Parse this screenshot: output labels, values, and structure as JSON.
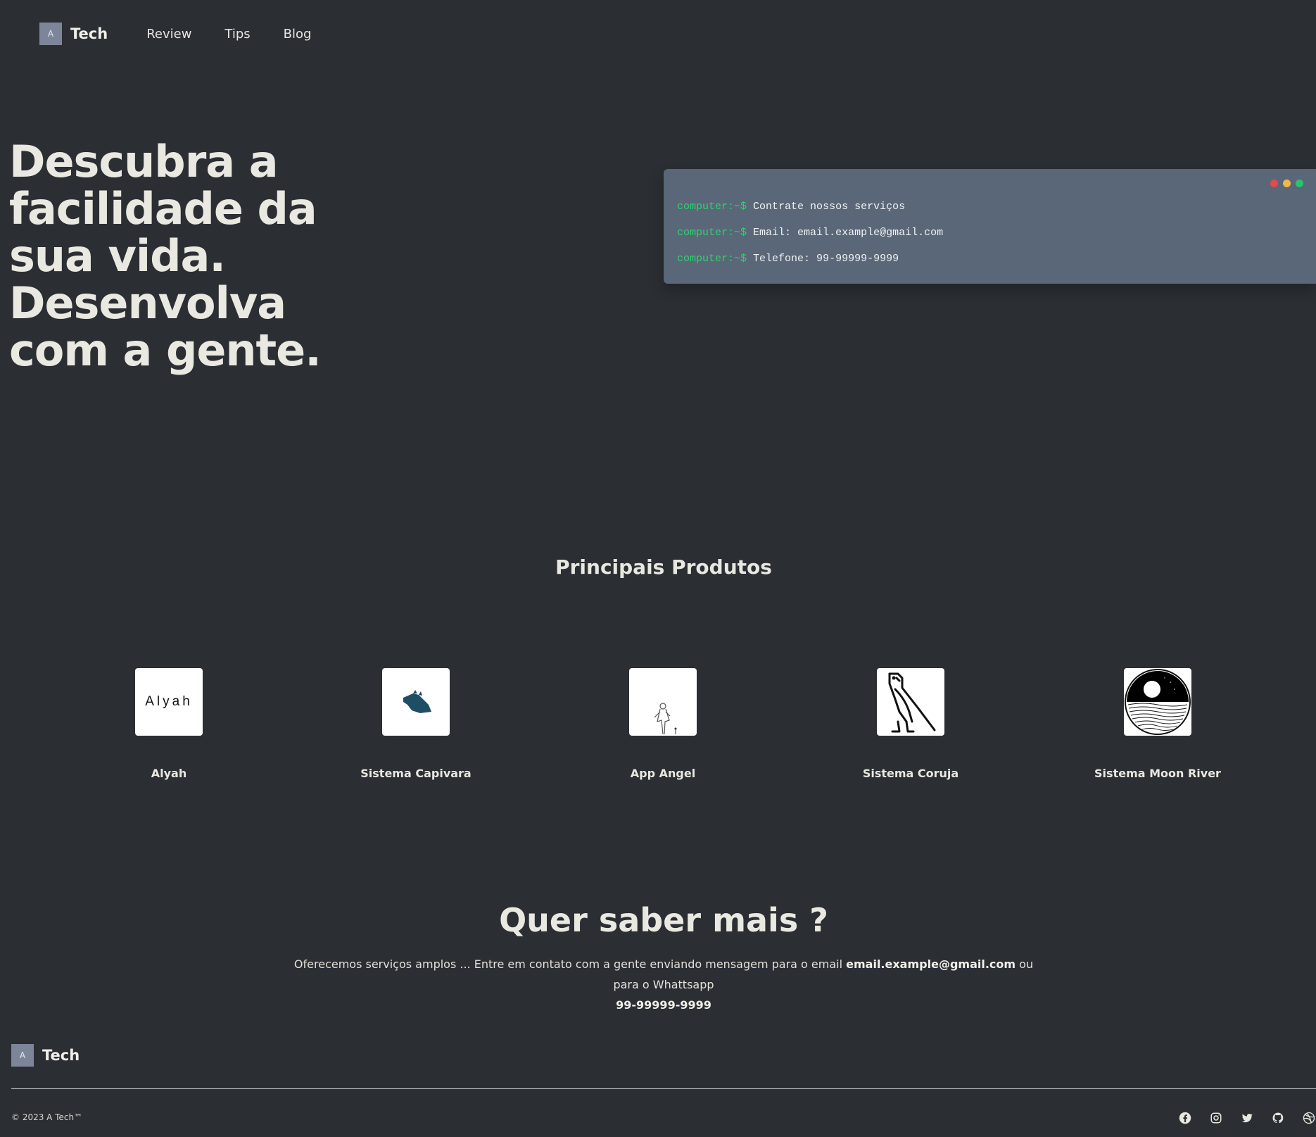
{
  "nav": {
    "logo_letter": "A",
    "logo_text": "Tech",
    "links": [
      "Review",
      "Tips",
      "Blog"
    ]
  },
  "hero": {
    "title": "Descubra a facilidade da sua vida. Desenvolva com a gente."
  },
  "terminal": {
    "prompt": "computer:~$",
    "lines": [
      "Contrate nossos serviços",
      "Email: email.example@gmail.com",
      "Telefone: 99-99999-9999"
    ]
  },
  "products": {
    "title": "Principais Produtos",
    "items": [
      {
        "name": "Alyah",
        "logo_text": "Alyah",
        "icon": "alyah-wordmark-icon"
      },
      {
        "name": "Sistema Capivara",
        "icon": "capybara-icon"
      },
      {
        "name": "App Angel",
        "icon": "angel-figure-icon"
      },
      {
        "name": "Sistema Coruja",
        "icon": "owl-icon"
      },
      {
        "name": "Sistema Moon River",
        "icon": "moon-river-icon"
      }
    ]
  },
  "cta": {
    "title": "Quer saber mais ?",
    "text_before": "Oferecemos serviços amplos ... Entre em contato com a gente enviando mensagem para o email ",
    "email": "email.example@gmail.com",
    "text_middle": " ou para o Whattsapp",
    "phone": "99-99999-9999"
  },
  "footer": {
    "logo_letter": "A",
    "logo_text": "Tech",
    "copyright": "© 2023 A Tech™",
    "socials": [
      "facebook-icon",
      "instagram-icon",
      "twitter-icon",
      "github-icon",
      "dribbble-icon"
    ]
  },
  "colors": {
    "background": "#2b2e33",
    "terminal": "#596778",
    "prompt": "#2fd36d",
    "logo_box": "#7d8699"
  }
}
